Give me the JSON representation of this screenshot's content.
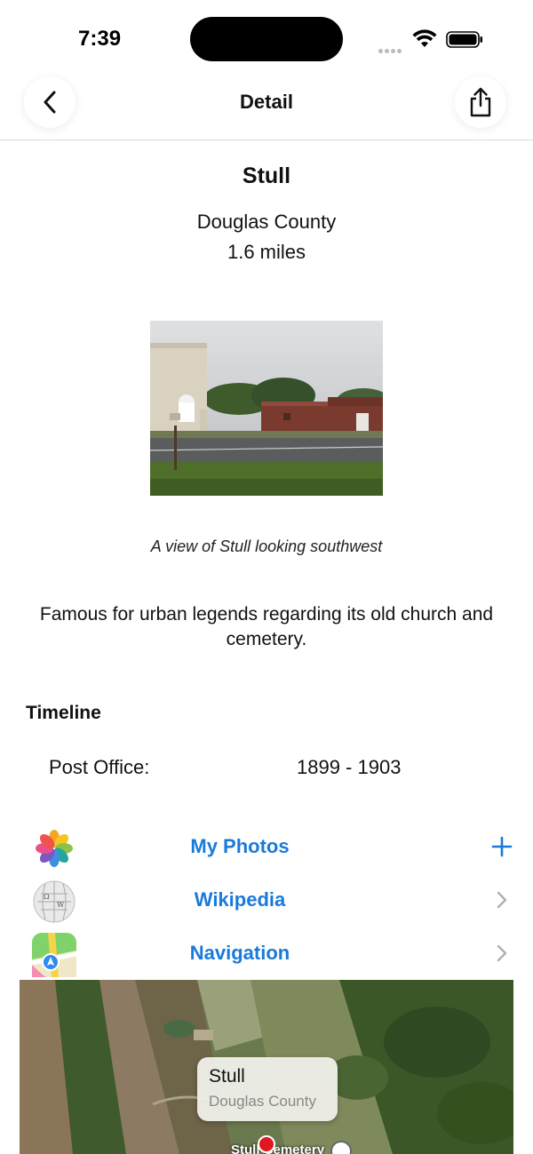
{
  "status": {
    "time": "7:39"
  },
  "nav": {
    "title": "Detail"
  },
  "place": {
    "name": "Stull",
    "county": "Douglas County",
    "distance": "1.6 miles",
    "photo_caption": "A view of Stull looking southwest",
    "description": "Famous for urban legends regarding its old church and cemetery."
  },
  "timeline": {
    "heading": "Timeline",
    "entries": [
      {
        "label": "Post Office:",
        "value": "1899 - 1903"
      }
    ]
  },
  "links": [
    {
      "label": "My Photos",
      "icon": "photos-icon",
      "trail_icon": "plus-icon"
    },
    {
      "label": "Wikipedia",
      "icon": "wikipedia-icon",
      "trail_icon": "chevron-right-icon"
    },
    {
      "label": "Navigation",
      "icon": "maps-icon",
      "trail_icon": "chevron-right-icon"
    }
  ],
  "map": {
    "callout_title": "Stull",
    "callout_subtitle": "Douglas County",
    "poi_label": "Stull Cemetery"
  },
  "colors": {
    "accent": "#1a7ad9",
    "pin": "#e0171f"
  }
}
